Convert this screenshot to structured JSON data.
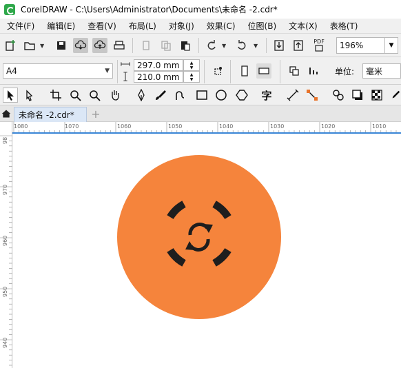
{
  "app": {
    "title": "CorelDRAW - C:\\Users\\Administrator\\Documents\\未命名 -2.cdr*"
  },
  "menu": [
    {
      "label": "文件(F)"
    },
    {
      "label": "编辑(E)"
    },
    {
      "label": "查看(V)"
    },
    {
      "label": "布局(L)"
    },
    {
      "label": "对象(J)"
    },
    {
      "label": "效果(C)"
    },
    {
      "label": "位图(B)"
    },
    {
      "label": "文本(X)"
    },
    {
      "label": "表格(T)"
    }
  ],
  "toolbar": {
    "zoom": "196%",
    "pdf_label": "PDF"
  },
  "property_bar": {
    "page_size": "A4",
    "width": "297.0 mm",
    "height": "210.0 mm",
    "units_label": "单位:",
    "units_value": "毫米"
  },
  "document_tab": {
    "name": "未命名 -2.cdr*"
  },
  "ruler": {
    "horizontal": [
      "1080",
      "1070",
      "1060",
      "1050",
      "1040",
      "1030",
      "1020",
      "1010"
    ],
    "vertical": [
      "98",
      "970",
      "960",
      "950",
      "940"
    ]
  },
  "artwork": {
    "circle_color": "#f5843c",
    "icon_color": "#1e1e1e",
    "icon_name": "sync-icon"
  }
}
